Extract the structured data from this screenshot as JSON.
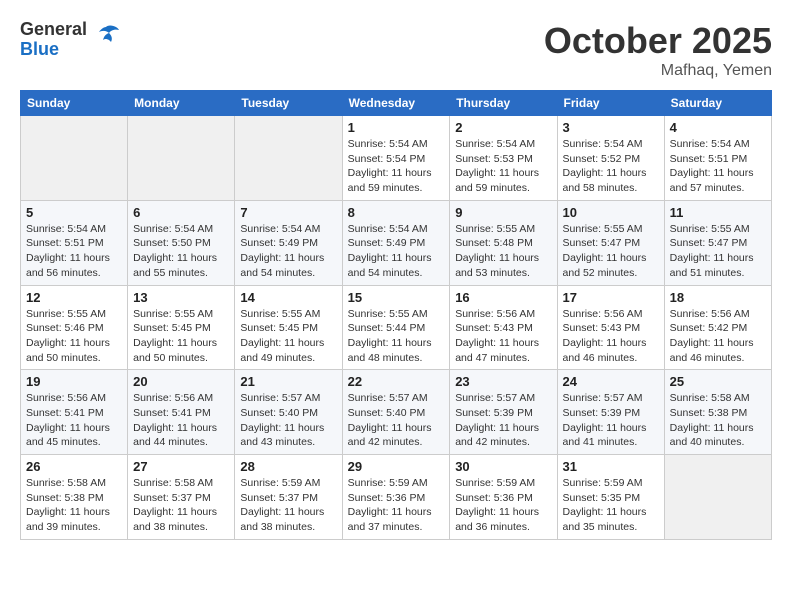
{
  "header": {
    "logo_general": "General",
    "logo_blue": "Blue",
    "month": "October 2025",
    "location": "Mafhaq, Yemen"
  },
  "weekdays": [
    "Sunday",
    "Monday",
    "Tuesday",
    "Wednesday",
    "Thursday",
    "Friday",
    "Saturday"
  ],
  "weeks": [
    [
      {
        "day": "",
        "info": ""
      },
      {
        "day": "",
        "info": ""
      },
      {
        "day": "",
        "info": ""
      },
      {
        "day": "1",
        "info": "Sunrise: 5:54 AM\nSunset: 5:54 PM\nDaylight: 11 hours\nand 59 minutes."
      },
      {
        "day": "2",
        "info": "Sunrise: 5:54 AM\nSunset: 5:53 PM\nDaylight: 11 hours\nand 59 minutes."
      },
      {
        "day": "3",
        "info": "Sunrise: 5:54 AM\nSunset: 5:52 PM\nDaylight: 11 hours\nand 58 minutes."
      },
      {
        "day": "4",
        "info": "Sunrise: 5:54 AM\nSunset: 5:51 PM\nDaylight: 11 hours\nand 57 minutes."
      }
    ],
    [
      {
        "day": "5",
        "info": "Sunrise: 5:54 AM\nSunset: 5:51 PM\nDaylight: 11 hours\nand 56 minutes."
      },
      {
        "day": "6",
        "info": "Sunrise: 5:54 AM\nSunset: 5:50 PM\nDaylight: 11 hours\nand 55 minutes."
      },
      {
        "day": "7",
        "info": "Sunrise: 5:54 AM\nSunset: 5:49 PM\nDaylight: 11 hours\nand 54 minutes."
      },
      {
        "day": "8",
        "info": "Sunrise: 5:54 AM\nSunset: 5:49 PM\nDaylight: 11 hours\nand 54 minutes."
      },
      {
        "day": "9",
        "info": "Sunrise: 5:55 AM\nSunset: 5:48 PM\nDaylight: 11 hours\nand 53 minutes."
      },
      {
        "day": "10",
        "info": "Sunrise: 5:55 AM\nSunset: 5:47 PM\nDaylight: 11 hours\nand 52 minutes."
      },
      {
        "day": "11",
        "info": "Sunrise: 5:55 AM\nSunset: 5:47 PM\nDaylight: 11 hours\nand 51 minutes."
      }
    ],
    [
      {
        "day": "12",
        "info": "Sunrise: 5:55 AM\nSunset: 5:46 PM\nDaylight: 11 hours\nand 50 minutes."
      },
      {
        "day": "13",
        "info": "Sunrise: 5:55 AM\nSunset: 5:45 PM\nDaylight: 11 hours\nand 50 minutes."
      },
      {
        "day": "14",
        "info": "Sunrise: 5:55 AM\nSunset: 5:45 PM\nDaylight: 11 hours\nand 49 minutes."
      },
      {
        "day": "15",
        "info": "Sunrise: 5:55 AM\nSunset: 5:44 PM\nDaylight: 11 hours\nand 48 minutes."
      },
      {
        "day": "16",
        "info": "Sunrise: 5:56 AM\nSunset: 5:43 PM\nDaylight: 11 hours\nand 47 minutes."
      },
      {
        "day": "17",
        "info": "Sunrise: 5:56 AM\nSunset: 5:43 PM\nDaylight: 11 hours\nand 46 minutes."
      },
      {
        "day": "18",
        "info": "Sunrise: 5:56 AM\nSunset: 5:42 PM\nDaylight: 11 hours\nand 46 minutes."
      }
    ],
    [
      {
        "day": "19",
        "info": "Sunrise: 5:56 AM\nSunset: 5:41 PM\nDaylight: 11 hours\nand 45 minutes."
      },
      {
        "day": "20",
        "info": "Sunrise: 5:56 AM\nSunset: 5:41 PM\nDaylight: 11 hours\nand 44 minutes."
      },
      {
        "day": "21",
        "info": "Sunrise: 5:57 AM\nSunset: 5:40 PM\nDaylight: 11 hours\nand 43 minutes."
      },
      {
        "day": "22",
        "info": "Sunrise: 5:57 AM\nSunset: 5:40 PM\nDaylight: 11 hours\nand 42 minutes."
      },
      {
        "day": "23",
        "info": "Sunrise: 5:57 AM\nSunset: 5:39 PM\nDaylight: 11 hours\nand 42 minutes."
      },
      {
        "day": "24",
        "info": "Sunrise: 5:57 AM\nSunset: 5:39 PM\nDaylight: 11 hours\nand 41 minutes."
      },
      {
        "day": "25",
        "info": "Sunrise: 5:58 AM\nSunset: 5:38 PM\nDaylight: 11 hours\nand 40 minutes."
      }
    ],
    [
      {
        "day": "26",
        "info": "Sunrise: 5:58 AM\nSunset: 5:38 PM\nDaylight: 11 hours\nand 39 minutes."
      },
      {
        "day": "27",
        "info": "Sunrise: 5:58 AM\nSunset: 5:37 PM\nDaylight: 11 hours\nand 38 minutes."
      },
      {
        "day": "28",
        "info": "Sunrise: 5:59 AM\nSunset: 5:37 PM\nDaylight: 11 hours\nand 38 minutes."
      },
      {
        "day": "29",
        "info": "Sunrise: 5:59 AM\nSunset: 5:36 PM\nDaylight: 11 hours\nand 37 minutes."
      },
      {
        "day": "30",
        "info": "Sunrise: 5:59 AM\nSunset: 5:36 PM\nDaylight: 11 hours\nand 36 minutes."
      },
      {
        "day": "31",
        "info": "Sunrise: 5:59 AM\nSunset: 5:35 PM\nDaylight: 11 hours\nand 35 minutes."
      },
      {
        "day": "",
        "info": ""
      }
    ]
  ]
}
